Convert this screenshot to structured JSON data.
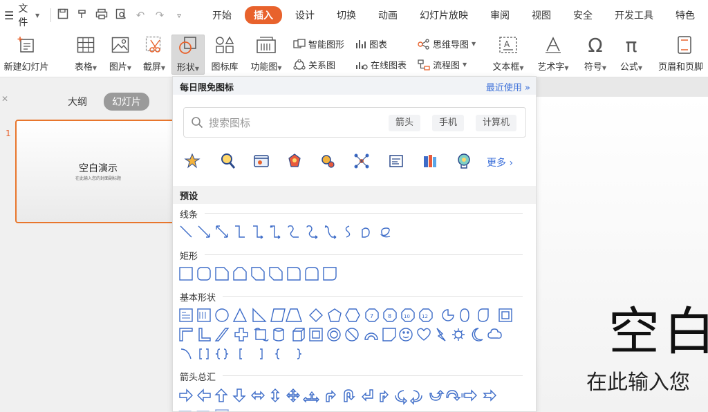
{
  "menubar": {
    "file_label": "文件",
    "tabs": [
      "开始",
      "插入",
      "设计",
      "切换",
      "动画",
      "幻灯片放映",
      "审阅",
      "视图",
      "安全",
      "开发工具",
      "特色"
    ],
    "active_tab": "插入"
  },
  "ribbon": {
    "new_slide": "新建幻灯片",
    "table": "表格",
    "picture": "图片",
    "screenshot": "截屏",
    "shape": "形状",
    "icon_lib": "图标库",
    "func_chart": "功能图",
    "smart_shape": "智能图形",
    "chart": "图表",
    "mind_map": "思维导图",
    "relation": "关系图",
    "online_chart": "在线图表",
    "flowchart": "流程图",
    "textbox": "文本框",
    "art_text": "艺术字",
    "symbol": "符号",
    "formula": "公式",
    "header_footer": "页眉和页脚"
  },
  "left_panel": {
    "outline_tab": "大纲",
    "slides_tab": "幻灯片",
    "slide_number": "1",
    "thumb_title": "空白演示",
    "thumb_subtitle": "在此输入您的封面副标题"
  },
  "canvas": {
    "title_partial": "空白",
    "subtitle_partial": "在此输入您"
  },
  "shape_panel": {
    "header": "每日限免图标",
    "recent": "最近使用",
    "search_placeholder": "搜索图标",
    "tags": [
      "箭头",
      "手机",
      "计算机"
    ],
    "more": "更多",
    "preset": "预设",
    "sections": {
      "lines": "线条",
      "rect": "矩形",
      "basic": "基本形状",
      "arrows": "箭头总汇"
    }
  },
  "colors": {
    "accent": "#e8622c",
    "link": "#3b6fd9",
    "shape_stroke": "#3d6cc8"
  }
}
